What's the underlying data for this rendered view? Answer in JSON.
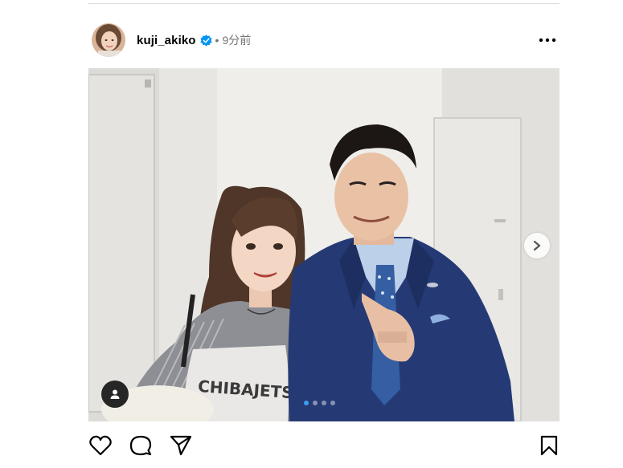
{
  "post": {
    "username": "kuji_akiko",
    "separator": "•",
    "time": "9分前",
    "verified": true
  },
  "carousel": {
    "slide_count": 4,
    "active_index": 0
  },
  "photo": {
    "jersey_text": "CHIBAJETS"
  },
  "icons": {
    "more": "more-horizontal-icon",
    "verified": "verified-badge-icon",
    "next": "chevron-right-icon",
    "tag": "user-tag-icon",
    "like": "heart-icon",
    "comment": "comment-icon",
    "share": "send-icon",
    "save": "bookmark-icon"
  },
  "colors": {
    "verified": "#0095f6",
    "active_dot": "#3d9bf0",
    "meta_text": "#737373"
  }
}
